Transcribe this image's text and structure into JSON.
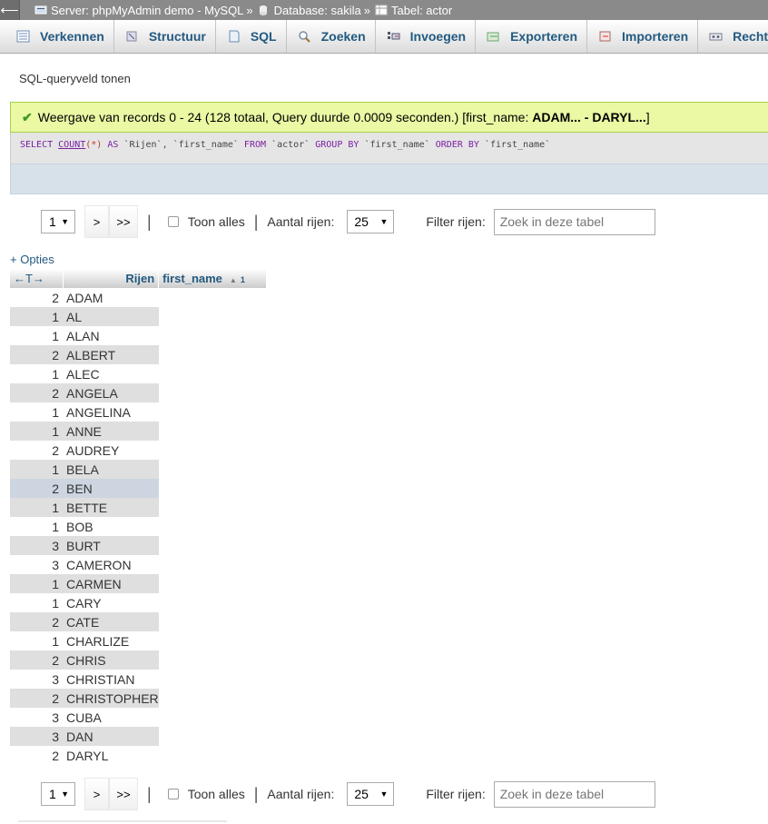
{
  "breadcrumb": {
    "back_glyph": "⟵",
    "server": "Server: phpMyAdmin demo - MySQL",
    "database": "Database: sakila",
    "table": "Tabel: actor",
    "separator": "»"
  },
  "tabs": [
    {
      "label": "Verkennen",
      "icon": "browse-icon"
    },
    {
      "label": "Structuur",
      "icon": "structure-icon"
    },
    {
      "label": "SQL",
      "icon": "sql-icon"
    },
    {
      "label": "Zoeken",
      "icon": "search-icon"
    },
    {
      "label": "Invoegen",
      "icon": "insert-icon"
    },
    {
      "label": "Exporteren",
      "icon": "export-icon"
    },
    {
      "label": "Importeren",
      "icon": "import-icon"
    },
    {
      "label": "Rechten",
      "icon": "privileges-icon"
    }
  ],
  "sql_toggle": "SQL-queryveld tonen",
  "message": {
    "text_before": "Weergave van records 0 - 24 (128 totaal, Query duurde 0.0009 seconden.) [first_name: ",
    "bold": "ADAM... - DARYL...",
    "text_after": "]"
  },
  "query": {
    "select": "SELECT",
    "count": "COUNT",
    "paren": "(*)",
    "as": "AS",
    "alias": "`Rijen`,",
    "col": "`first_name`",
    "from": "FROM",
    "table": "`actor`",
    "groupby": "GROUP BY",
    "col2": "`first_name`",
    "orderby": "ORDER BY",
    "col3": "`first_name`"
  },
  "navigation": {
    "page": "1",
    "next": ">",
    "last": ">>",
    "show_all": "Toon alles",
    "rows_label": "Aantal rijen:",
    "rows_value": "25",
    "filter_label": "Filter rijen:",
    "filter_placeholder": "Zoek in deze tabel",
    "divider": "|"
  },
  "options_link": "+ Opties",
  "table": {
    "ctrl_glyph": "←T→",
    "col_count": "Rijen",
    "col_name": "first_name",
    "sort_indicator": "▲",
    "sort_order": "1",
    "highlighted_row": 10,
    "rows": [
      {
        "count": "2",
        "name": "ADAM"
      },
      {
        "count": "1",
        "name": "AL"
      },
      {
        "count": "1",
        "name": "ALAN"
      },
      {
        "count": "2",
        "name": "ALBERT"
      },
      {
        "count": "1",
        "name": "ALEC"
      },
      {
        "count": "2",
        "name": "ANGELA"
      },
      {
        "count": "1",
        "name": "ANGELINA"
      },
      {
        "count": "1",
        "name": "ANNE"
      },
      {
        "count": "2",
        "name": "AUDREY"
      },
      {
        "count": "1",
        "name": "BELA"
      },
      {
        "count": "2",
        "name": "BEN"
      },
      {
        "count": "1",
        "name": "BETTE"
      },
      {
        "count": "1",
        "name": "BOB"
      },
      {
        "count": "3",
        "name": "BURT"
      },
      {
        "count": "3",
        "name": "CAMERON"
      },
      {
        "count": "1",
        "name": "CARMEN"
      },
      {
        "count": "1",
        "name": "CARY"
      },
      {
        "count": "2",
        "name": "CATE"
      },
      {
        "count": "1",
        "name": "CHARLIZE"
      },
      {
        "count": "2",
        "name": "CHRIS"
      },
      {
        "count": "3",
        "name": "CHRISTIAN"
      },
      {
        "count": "2",
        "name": "CHRISTOPHER"
      },
      {
        "count": "3",
        "name": "CUBA"
      },
      {
        "count": "3",
        "name": "DAN"
      },
      {
        "count": "2",
        "name": "DARYL"
      }
    ]
  }
}
